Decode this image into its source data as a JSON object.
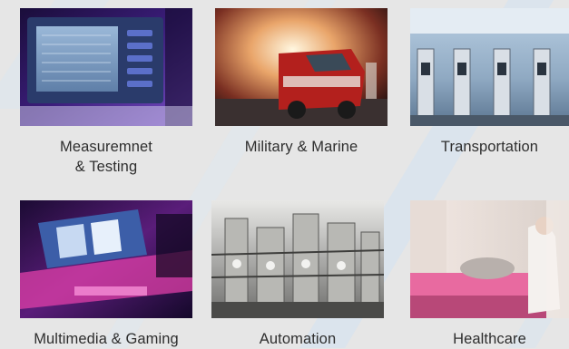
{
  "industries": [
    {
      "label": "Measuremnet\n& Testing",
      "icon": "measurement-testing-photo"
    },
    {
      "label": "Military & Marine",
      "icon": "military-marine-photo"
    },
    {
      "label": "Transportation",
      "icon": "transportation-photo"
    },
    {
      "label": "Multimedia & Gaming",
      "icon": "multimedia-gaming-photo"
    },
    {
      "label": "Automation",
      "icon": "automation-photo"
    },
    {
      "label": "Healthcare",
      "icon": "healthcare-photo"
    }
  ],
  "colors": {
    "background": "#e6e6e6",
    "accent_stripe": "#cfe0f0",
    "caption_text": "#2e2e2e"
  }
}
